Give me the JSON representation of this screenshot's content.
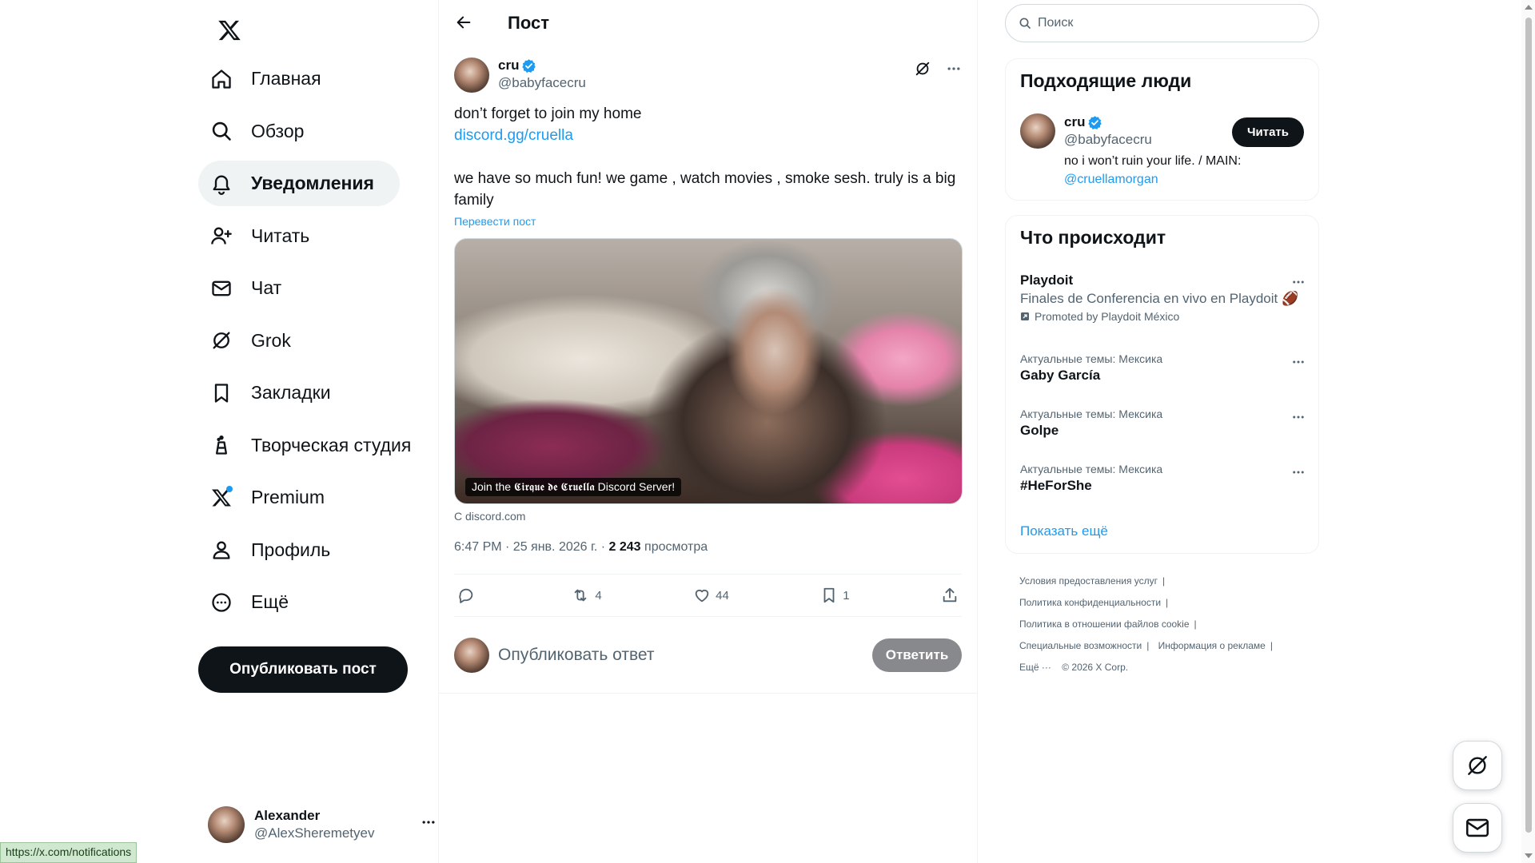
{
  "sidebar": {
    "logo": "x-logo-icon",
    "items": [
      {
        "label": "Главная",
        "icon": "home-icon"
      },
      {
        "label": "Обзор",
        "icon": "search-icon"
      },
      {
        "label": "Уведомления",
        "icon": "bell-icon",
        "active": true
      },
      {
        "label": "Читать",
        "icon": "follow-icon"
      },
      {
        "label": "Чат",
        "icon": "mail-icon"
      },
      {
        "label": "Grok",
        "icon": "grok-icon"
      },
      {
        "label": "Закладки",
        "icon": "bookmark-icon"
      },
      {
        "label": "Творческая студия",
        "icon": "studio-icon"
      },
      {
        "label": "Premium",
        "icon": "x-premium-icon"
      },
      {
        "label": "Профиль",
        "icon": "profile-icon"
      },
      {
        "label": "Ещё",
        "icon": "more-circle-icon"
      }
    ],
    "post_button": "Опубликовать пост",
    "account": {
      "name": "Alexander",
      "handle": "@AlexSheremetyev"
    }
  },
  "main": {
    "title": "Пост",
    "post": {
      "author_name": "cru",
      "author_handle": "@babyfacecru",
      "text_line1": "don’t forget to join my home",
      "link": "discord.gg/cruella",
      "text_body": "we have so much fun! we game , watch movies , smoke sesh. truly is a big family",
      "translate": "Перевести пост",
      "media_caption": "Join the 𝕮𝖎𝖗𝖖𝖚𝖊 𝖉𝖊 𝕮𝖗𝖚𝖊𝖑𝖑𝖆 Discord Server!",
      "from": "С discord.com",
      "time": "6:47 PM · 25 янв. 2026 г. · ",
      "views_count": "2 243",
      "views_label": " просмотра",
      "stats": {
        "replies": "",
        "reposts": "4",
        "likes": "44",
        "bookmarks": "1"
      }
    },
    "reply": {
      "placeholder": "Опубликовать ответ",
      "button": "Ответить"
    }
  },
  "right": {
    "search": {
      "placeholder": "Поиск"
    },
    "who_to_follow": {
      "title": "Подходящие люди",
      "name": "cru",
      "handle": "@babyfacecru",
      "bio_text": "no i won’t ruin your life. / MAIN: ",
      "bio_link": "@cruellamorgan",
      "follow_label": "Читать"
    },
    "trends": {
      "title": "Что происходит",
      "promoted": {
        "title": "Playdoit",
        "description": "Finales de Conferencia en vivo en Playdoit",
        "emoji": "🏈",
        "promoted_by": "Promoted by Playdoit México"
      },
      "items": [
        {
          "context": "Актуальные темы: Мексика",
          "title": "Gaby García"
        },
        {
          "context": "Актуальные темы: Мексика",
          "title": "Golpe"
        },
        {
          "context": "Актуальные темы: Мексика",
          "title": "#HeForShe"
        }
      ],
      "show_more": "Показать ещё"
    },
    "footer": {
      "terms": "Условия предоставления услуг",
      "privacy": "Политика конфиденциальности",
      "cookies": "Политика в отношении файлов cookie",
      "accessibility": "Специальные возможности",
      "ads": "Информация о рекламе",
      "more": "Ещё ···",
      "copyright": "© 2026 X Corp."
    }
  },
  "status_bar": {
    "url": "https://x.com/notifications"
  },
  "colors": {
    "accent": "#1d9bf0",
    "text": "#0f1419",
    "muted": "#536471",
    "active_bg": "#eff3f4"
  }
}
